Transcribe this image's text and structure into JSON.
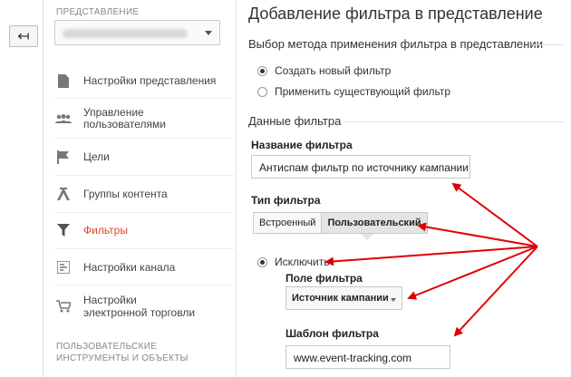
{
  "sidebar": {
    "section_title": "ПРЕДСТАВЛЕНИЕ",
    "items": [
      {
        "label": "Настройки представления",
        "icon": "document-icon"
      },
      {
        "label": "Управление пользователями",
        "icon": "users-icon"
      },
      {
        "label": "Цели",
        "icon": "flag-icon"
      },
      {
        "label": "Группы контента",
        "icon": "content-group-icon"
      },
      {
        "label": "Фильтры",
        "icon": "filter-icon",
        "active": true
      },
      {
        "label": "Настройки канала",
        "icon": "channel-icon"
      },
      {
        "label": "Настройки электронной торговли",
        "icon": "cart-icon"
      }
    ],
    "bottom_section_title": "ПОЛЬЗОВАТЕЛЬСКИЕ ИНСТРУМЕНТЫ И ОБЪЕКТЫ"
  },
  "main": {
    "title": "Добавление фильтра в представление",
    "method_heading": "Выбор метода применения фильтра в представлении",
    "radio_create": "Создать новый фильтр",
    "radio_apply": "Применить существующий фильтр",
    "data_heading": "Данные фильтра",
    "filter_name_label": "Название фильтра",
    "filter_name_value": "Антиспам фильтр по источнику кампании",
    "filter_type_label": "Тип фильтра",
    "type_builtin": "Встроенный",
    "type_custom": "Пользовательский",
    "exclude_label": "Исключить",
    "filter_field_label": "Поле фильтра",
    "filter_field_value": "Источник кампании",
    "filter_pattern_label": "Шаблон фильтра",
    "filter_pattern_value": "www.event-tracking.com"
  },
  "colors": {
    "accent": "#d9442d",
    "arrow": "#e00000"
  }
}
